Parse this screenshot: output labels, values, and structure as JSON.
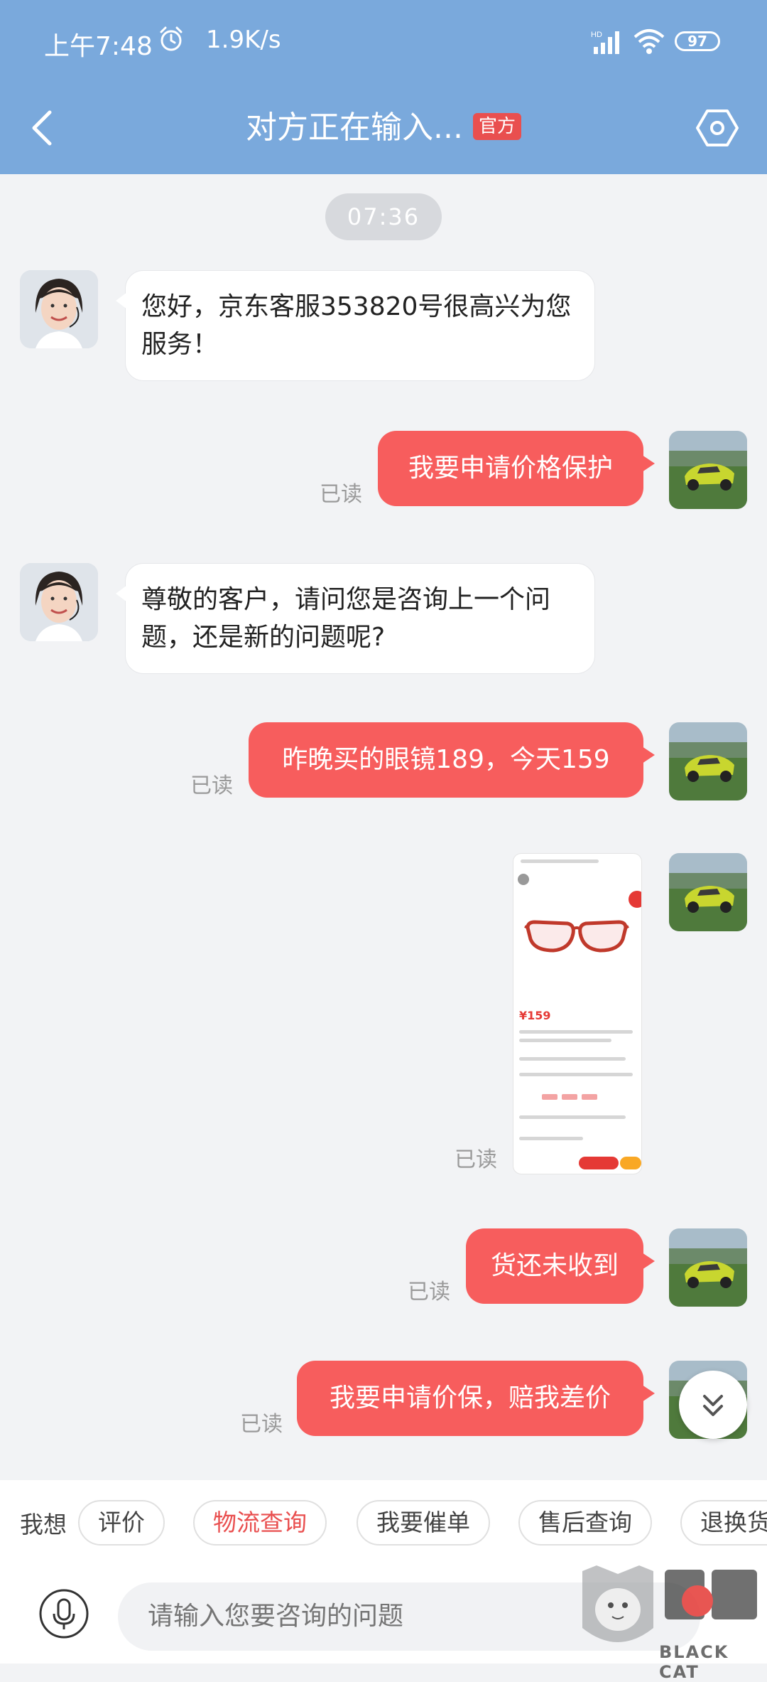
{
  "status_bar": {
    "time": "上午7:48",
    "speed": "1.9K/s",
    "network": "HD",
    "battery": "97"
  },
  "nav": {
    "title": "对方正在输入...",
    "badge": "官方"
  },
  "chat": {
    "timestamp": "07:36",
    "messages": [
      {
        "from": "agent",
        "text": "您好，京东客服353820号很高兴为您服务！"
      },
      {
        "from": "user",
        "text": "我要申请价格保护",
        "status": "已读"
      },
      {
        "from": "agent",
        "text": "尊敬的客户，请问您是咨询上一个问题，还是新的问题呢?"
      },
      {
        "from": "user",
        "text": "昨晚买的眼镜189，今天159",
        "status": "已读"
      },
      {
        "from": "user",
        "type": "image",
        "status": "已读"
      },
      {
        "from": "user",
        "text": "货还未收到",
        "status": "已读"
      },
      {
        "from": "user",
        "text": "我要申请价保，赔我差价",
        "status": "已读"
      }
    ],
    "screenshot_price": "¥159"
  },
  "quick_bar": {
    "title": "我想",
    "chips": [
      "评价",
      "物流查询",
      "我要催单",
      "售后查询",
      "退换货"
    ]
  },
  "input": {
    "placeholder": "请输入您要咨询的问题"
  },
  "watermark": {
    "text": "BLACK CAT"
  },
  "colors": {
    "header_bg": "#7aa9dc",
    "user_bubble": "#f75d5d",
    "chat_bg": "#f2f3f5",
    "badge_red": "#e94f4f"
  },
  "icons": [
    "alarm-icon",
    "signal-icon",
    "wifi-icon",
    "back-chevron-icon",
    "settings-hex-icon",
    "chevron-double-down-icon",
    "microphone-icon"
  ]
}
